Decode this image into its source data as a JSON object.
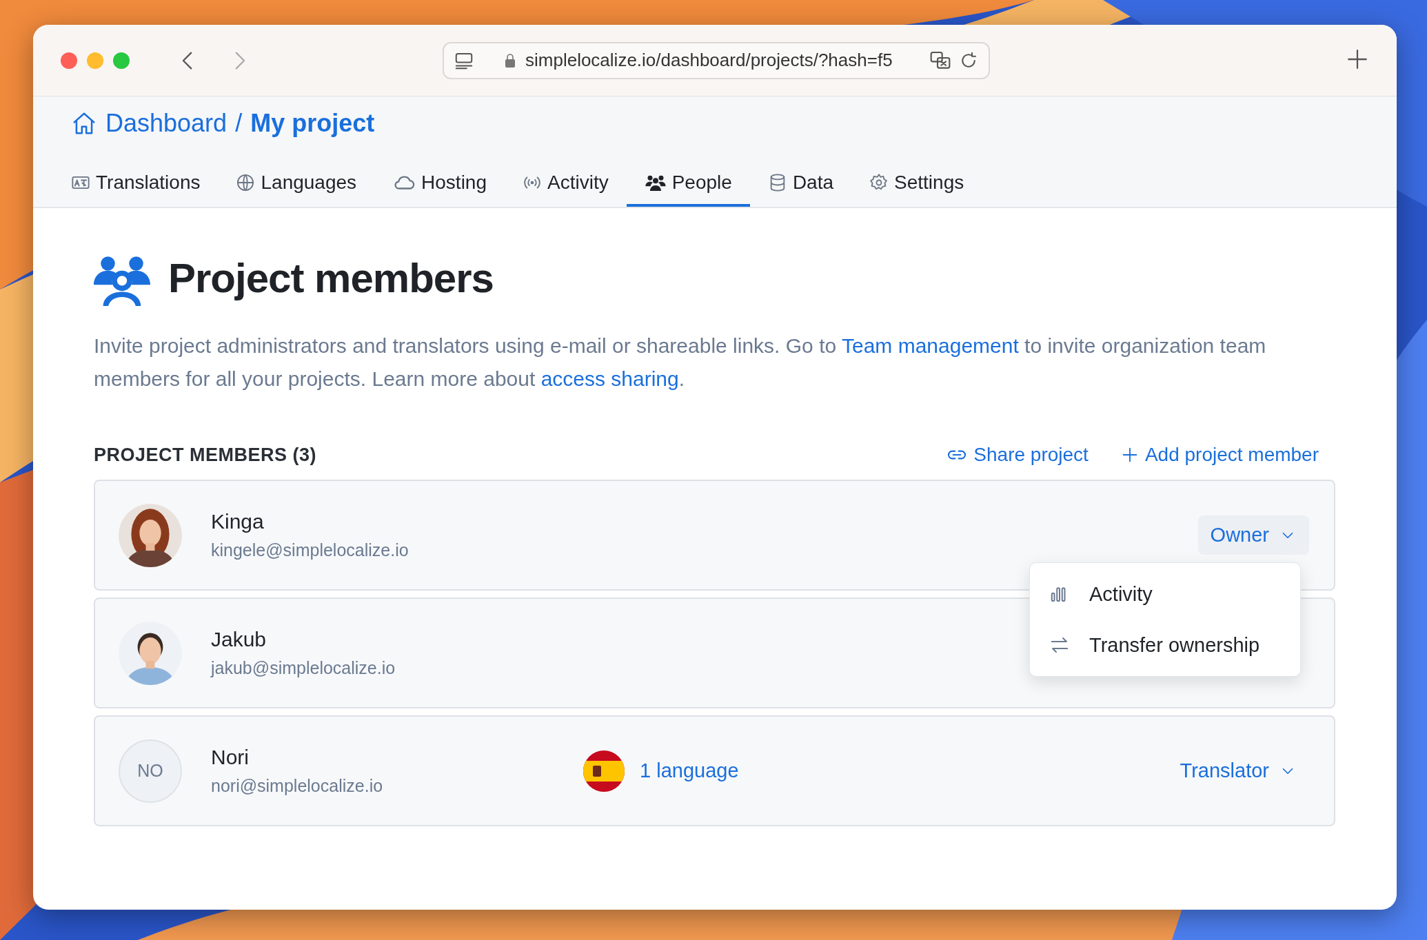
{
  "browser": {
    "url": "simplelocalize.io/dashboard/projects/?hash=f5"
  },
  "breadcrumb": [
    {
      "label": "Dashboard"
    },
    {
      "label": "My project"
    }
  ],
  "separator": "/",
  "tabs": [
    {
      "label": "Translations",
      "selected": false
    },
    {
      "label": "Languages",
      "selected": false
    },
    {
      "label": "Hosting",
      "selected": false
    },
    {
      "label": "Activity",
      "selected": false
    },
    {
      "label": "People",
      "selected": true
    },
    {
      "label": "Data",
      "selected": false
    },
    {
      "label": "Settings",
      "selected": false
    }
  ],
  "page": {
    "title": "Project members",
    "description": [
      {
        "kind": "text",
        "text": "Invite project administrators and translators using e-mail or shareable links. Go to "
      },
      {
        "kind": "link",
        "text": "Team management"
      },
      {
        "kind": "text",
        "text": " to invite organization team members for all your projects. Learn more about "
      },
      {
        "kind": "link",
        "text": "access sharing"
      },
      {
        "kind": "text",
        "text": "."
      }
    ]
  },
  "members_section": {
    "heading": "PROJECT MEMBERS (3)",
    "actions": [
      {
        "label": "Share project"
      },
      {
        "label": "Add project member"
      }
    ]
  },
  "members": [
    {
      "name": "Kinga",
      "email": "kingele@simplelocalize.io",
      "role": {
        "label": "Owner",
        "expanded": true
      }
    },
    {
      "name": "Jakub",
      "email": "jakub@simplelocalize.io"
    },
    {
      "name": "Nori",
      "email": "nori@simplelocalize.io",
      "avatar": {
        "kind": "initials",
        "text": "NO"
      },
      "languages": "1 language",
      "role": {
        "label": "Translator",
        "expanded": false
      }
    }
  ],
  "role_menu": {
    "items": [
      {
        "label": "Activity"
      },
      {
        "label": "Transfer ownership"
      }
    ]
  }
}
